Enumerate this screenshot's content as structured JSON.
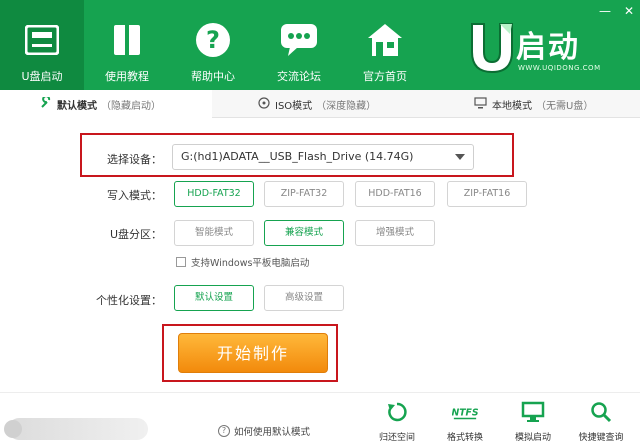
{
  "colors": {
    "brand_green": "#16a350",
    "active_green": "#0f8a40",
    "highlight_red": "#c8161d",
    "start_orange": "#f28a0c"
  },
  "window": {
    "minimize": "—",
    "close": "✕"
  },
  "nav": [
    {
      "label": "U盘启动",
      "icon": "usb-drive-icon"
    },
    {
      "label": "使用教程",
      "icon": "book-icon"
    },
    {
      "label": "帮助中心",
      "icon": "question-icon"
    },
    {
      "label": "交流论坛",
      "icon": "chat-bubble-icon"
    },
    {
      "label": "官方首页",
      "icon": "home-icon"
    }
  ],
  "logo": {
    "text": "启动",
    "url": "WWW.UQIDONG.COM"
  },
  "modes": [
    {
      "label": "默认模式",
      "sub": "（隐藏启动）",
      "icon": "wrench-icon"
    },
    {
      "label": "ISO模式",
      "sub": "（深度隐藏）",
      "icon": "disc-icon"
    },
    {
      "label": "本地模式",
      "sub": "（无需U盘）",
      "icon": "monitor-icon"
    }
  ],
  "form": {
    "device_label": "选择设备：",
    "device_value": "G:(hd1)ADATA__USB_Flash_Drive (14.74G)",
    "write_label": "写入模式：",
    "write_options": [
      "HDD-FAT32",
      "ZIP-FAT32",
      "HDD-FAT16",
      "ZIP-FAT16"
    ],
    "partition_label": "U盘分区：",
    "partition_options": [
      "智能模式",
      "兼容模式",
      "增强模式"
    ],
    "tablet_check": "支持Windows平板电脑启动",
    "personal_label": "个性化设置：",
    "personal_options": [
      "默认设置",
      "高级设置"
    ],
    "start_button": "开始制作"
  },
  "footer": {
    "help_link": "如何使用默认模式",
    "tools": [
      {
        "label": "归还空间",
        "icon": "restore-icon"
      },
      {
        "label": "格式转换",
        "icon": "ntfs-icon",
        "icon_text": "NTFS"
      },
      {
        "label": "模拟启动",
        "icon": "monitor-icon"
      },
      {
        "label": "快捷键查询",
        "icon": "search-icon"
      }
    ]
  }
}
